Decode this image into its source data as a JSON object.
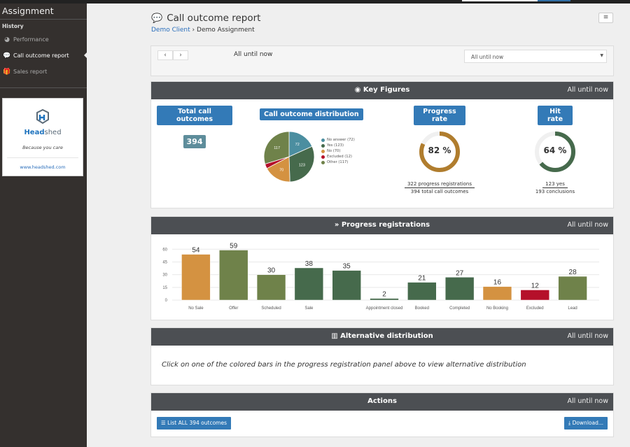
{
  "sidebar": {
    "title": "Assignment",
    "section": "History",
    "items": [
      {
        "label": "Performance",
        "icon": "dashboard-icon",
        "active": false
      },
      {
        "label": "Call outcome report",
        "icon": "comments-icon",
        "active": true
      },
      {
        "label": "Sales report",
        "icon": "gift-icon",
        "active": false
      }
    ],
    "brand": {
      "name_part1": "Head",
      "name_part2": "shed",
      "tagline": "Because you care",
      "link": "www.headshed.com"
    }
  },
  "header": {
    "title": "Call outcome report",
    "breadcrumb": {
      "client": "Demo Client",
      "separator": "›",
      "assignment": "Demo Assignment"
    },
    "menu_icon": "≡"
  },
  "filter": {
    "prev": "‹",
    "next": "›",
    "label": "All until now",
    "select_value": "All until now"
  },
  "key_figures": {
    "title": "Key Figures",
    "period": "All until now",
    "total": {
      "label": "Total call outcomes",
      "value": "394"
    },
    "distribution": {
      "label": "Call outcome distribution"
    },
    "progress_rate": {
      "label": "Progress rate",
      "value": 82,
      "display": "82 %",
      "numerator": "322 progress registrations",
      "denominator": "394 total call outcomes",
      "color": "#b07d2e"
    },
    "hit_rate": {
      "label": "Hit rate",
      "value": 64,
      "display": "64 %",
      "numerator": "123 yes",
      "denominator": "193 conclusions",
      "color": "#466a4c"
    }
  },
  "progress": {
    "title": "Progress registrations",
    "period": "All until now"
  },
  "alternative": {
    "title": "Alternative distribution",
    "period": "All until now",
    "message": "Click on one of the colored bars in the progress registration panel above to view alternative distribution"
  },
  "actions": {
    "title": "Actions",
    "period": "All until now",
    "list_button": "List ALL 394 outcomes",
    "download_button": "Download..."
  },
  "chart_data": [
    {
      "type": "pie",
      "title": "Call outcome distribution",
      "categories": [
        "No answer",
        "Yes",
        "No",
        "Excluded",
        "Other"
      ],
      "values": [
        72,
        123,
        70,
        12,
        117
      ],
      "legend": [
        "No answer (72)",
        "Yes (123)",
        "No (70)",
        "Excluded (12)",
        "Other (117)"
      ],
      "colors": [
        "#4b8ea0",
        "#466a4c",
        "#d49241",
        "#b5102a",
        "#6f824a"
      ],
      "legend_position": "right"
    },
    {
      "type": "bar",
      "title": "Progress registrations",
      "categories": [
        "No Sale",
        "Offer",
        "Scheduled",
        "Sale",
        "",
        "Appointment closed",
        "Booked",
        "Completed",
        "No Booking",
        "Excluded",
        "Lead"
      ],
      "values": [
        54,
        59,
        30,
        38,
        35,
        2,
        21,
        27,
        16,
        12,
        28
      ],
      "colors": [
        "#d49241",
        "#6f824a",
        "#6f824a",
        "#466a4c",
        "#466a4c",
        "#466a4c",
        "#466a4c",
        "#466a4c",
        "#d49241",
        "#b5102a",
        "#6f824a"
      ],
      "yticks": [
        0,
        15,
        30,
        45,
        60
      ],
      "ylim": [
        0,
        66
      ],
      "grid": true,
      "xlabel": "",
      "ylabel": ""
    }
  ]
}
